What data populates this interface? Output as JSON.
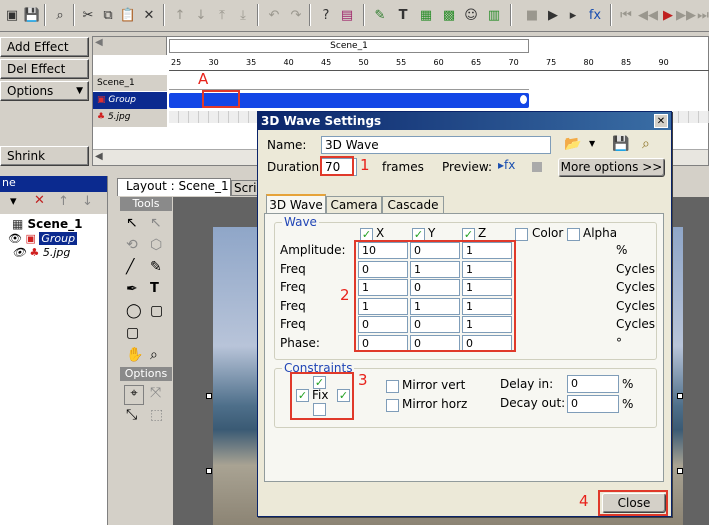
{
  "toolbar": {
    "icons": [
      "app-icon",
      "save-icon",
      "binoculars-icon",
      "cut-icon",
      "copy-icon",
      "paste-icon",
      "delete-icon",
      "move-up-icon",
      "move-down-icon",
      "move-top-icon",
      "move-bottom-icon",
      "undo-icon",
      "redo-icon",
      "help-icon",
      "book-icon",
      "add-scene-icon",
      "add-text-icon",
      "add-image-icon",
      "add-wave-icon",
      "add-sprite-icon",
      "add-layer-icon",
      "stop-icon",
      "play-icon",
      "play-from-icon",
      "effect-icon",
      "rewind-icon",
      "prev-icon",
      "next-frame-icon",
      "next-icon",
      "end-icon"
    ]
  },
  "effects_panel": {
    "add_effect": "Add Effect",
    "del_effect": "Del Effect",
    "options": "Options",
    "shrink": "Shrink"
  },
  "timeline": {
    "scene_header": "Scene_1",
    "ruler_labels": [
      "25",
      "30",
      "35",
      "40",
      "45",
      "50",
      "55",
      "60",
      "65",
      "70",
      "75",
      "80",
      "85",
      "90"
    ],
    "tracks": [
      "Scene_1",
      "Group",
      "5.jpg"
    ]
  },
  "objects_panel": {
    "title": "ne",
    "items": [
      {
        "label": "Scene_1"
      },
      {
        "label": "Group"
      },
      {
        "label": "5.jpg"
      }
    ]
  },
  "layout": {
    "tab_active": "Layout : Scene_1",
    "tab_other": "Scri",
    "tools_header": "Tools",
    "options_header": "Options"
  },
  "annotations": {
    "a": "A",
    "n1": "1",
    "n2": "2",
    "n3": "3",
    "n4": "4"
  },
  "dialog": {
    "title": "3D Wave Settings",
    "name_label": "Name:",
    "name_value": "3D Wave",
    "duration_label": "Duration:",
    "duration_value": "70",
    "frames_label": "frames",
    "preview_label": "Preview:",
    "more_options": "More options >>",
    "tabs": [
      "3D Wave",
      "Camera",
      "Cascade"
    ],
    "wave_group": "Wave",
    "col_x": "X",
    "col_y": "Y",
    "col_z": "Z",
    "color_label": "Color",
    "alpha_label": "Alpha",
    "rows": [
      {
        "label": "Amplitude:",
        "x": "10",
        "y": "0",
        "z": "1",
        "unit": "%"
      },
      {
        "label": "Freq",
        "x": "0",
        "y": "1",
        "z": "1",
        "unit": "Cycles"
      },
      {
        "label": "Freq",
        "x": "1",
        "y": "0",
        "z": "1",
        "unit": "Cycles"
      },
      {
        "label": "Freq",
        "x": "1",
        "y": "1",
        "z": "1",
        "unit": "Cycles"
      },
      {
        "label": "Freq",
        "x": "0",
        "y": "0",
        "z": "1",
        "unit": "Cycles"
      },
      {
        "label": "Phase:",
        "x": "0",
        "y": "0",
        "z": "0",
        "unit": "°"
      }
    ],
    "constraints_group": "Constraints",
    "fix_label": "Fix",
    "mirror_vert": "Mirror vert",
    "mirror_horz": "Mirror horz",
    "delay_in_label": "Delay in:",
    "delay_in_value": "0",
    "decay_out_label": "Decay out:",
    "decay_out_value": "0",
    "pct": "%",
    "close": "Close"
  }
}
